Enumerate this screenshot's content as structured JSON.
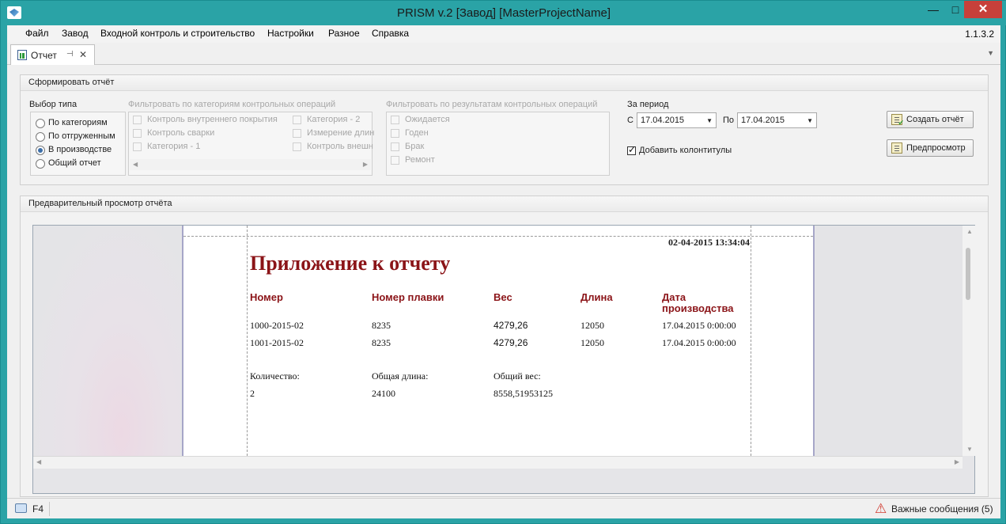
{
  "window": {
    "title": "PRISM v.2 [Завод] [MasterProjectName]",
    "minimize": "—",
    "maximize": "□",
    "close": "✕"
  },
  "menu": {
    "items": [
      "Файл",
      "Завод",
      "Входной контроль и строительство",
      "Настройки",
      "Разное",
      "Справка"
    ],
    "version": "1.1.3.2"
  },
  "tabs": [
    {
      "label": "Отчет",
      "pin": "⊣",
      "close": "✕"
    }
  ],
  "form": {
    "title": "Сформировать отчёт",
    "type_select": {
      "label": "Выбор типа",
      "options": [
        "По категориям",
        "По отгруженным",
        "В производстве",
        "Общий отчет"
      ],
      "selected": "В производстве"
    },
    "filter_categories": {
      "label": "Фильтровать по категориям контрольных операций",
      "col1": [
        "Контроль внутреннего покрытия",
        "Контроль сварки",
        "Категория - 1"
      ],
      "col2": [
        "Категория - 2",
        "Измерение длин",
        "Контроль внешн"
      ]
    },
    "filter_results": {
      "label": "Фильтровать по результатам контрольных операций",
      "options": [
        "Ожидается",
        "Годен",
        "Брак",
        "Ремонт"
      ]
    },
    "period": {
      "label": "За период",
      "from_label": "С",
      "from_value": "17.04.2015",
      "to_label": "По",
      "to_value": "17.04.2015"
    },
    "headers_footers": {
      "label": "Добавить колонтитулы",
      "checked": true
    },
    "create_button": "Создать отчёт",
    "preview_button": "Предпросмотр"
  },
  "preview": {
    "title": "Предварительный просмотр отчёта",
    "report": {
      "datetime": "02-04-2015 13:34:04",
      "heading": "Приложение к отчету",
      "columns": [
        "Номер",
        "Номер плавки",
        "Вес",
        "Длина",
        "Дата производства"
      ],
      "rows": [
        [
          "1000-2015-02",
          "8235",
          "4279,26",
          "12050",
          "17.04.2015 0:00:00"
        ],
        [
          "1001-2015-02",
          "8235",
          "4279,26",
          "12050",
          "17.04.2015 0:00:00"
        ]
      ],
      "summary_labels": [
        "Количество:",
        "Общая длина:",
        "Общий вес:"
      ],
      "summary_values": [
        "2",
        "24100",
        "8558,51953125"
      ]
    }
  },
  "status": {
    "key": "F4",
    "messages": "Важные сообщения (5)"
  },
  "colors": {
    "titlebar": "#2aa3a6",
    "report_accent": "#8b1418",
    "close_button": "#c7403a"
  }
}
